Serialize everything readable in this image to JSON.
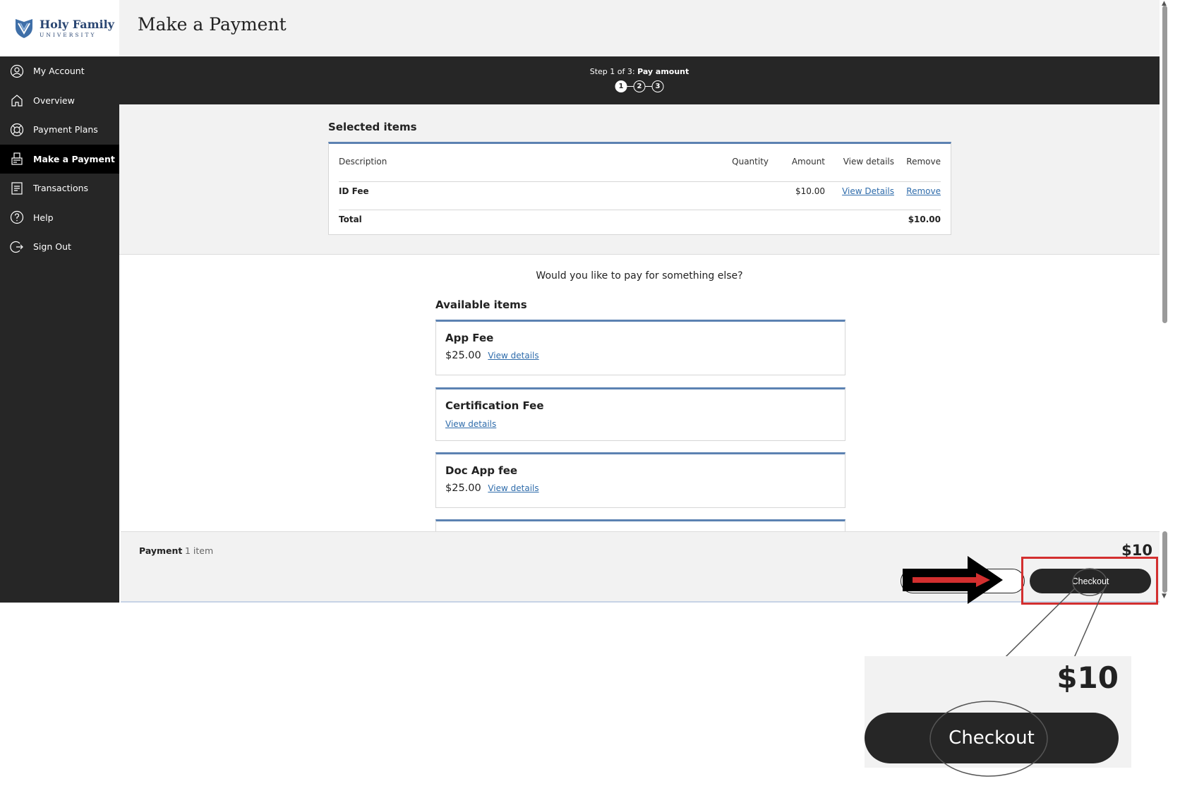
{
  "logo": {
    "name": "Holy Family",
    "sub": "UNIVERSITY"
  },
  "header": {
    "title": "Make a Payment"
  },
  "sidebar": {
    "items": [
      {
        "label": "My Account",
        "icon": "user-circle-icon",
        "active": false
      },
      {
        "label": "Overview",
        "icon": "home-icon",
        "active": false
      },
      {
        "label": "Payment Plans",
        "icon": "lifebuoy-icon",
        "active": false
      },
      {
        "label": "Make a Payment",
        "icon": "payment-terminal-icon",
        "active": true
      },
      {
        "label": "Transactions",
        "icon": "receipt-icon",
        "active": false
      },
      {
        "label": "Help",
        "icon": "help-circle-icon",
        "active": false
      },
      {
        "label": "Sign Out",
        "icon": "sign-out-icon",
        "active": false
      }
    ]
  },
  "stepper": {
    "prefix": "Step 1 of 3:",
    "current_step": "Pay amount",
    "steps": [
      "1",
      "2",
      "3"
    ],
    "current_index": 0
  },
  "selected": {
    "heading": "Selected items",
    "columns": {
      "description": "Description",
      "quantity": "Quantity",
      "amount": "Amount",
      "view_details": "View details",
      "remove": "Remove"
    },
    "rows": [
      {
        "description": "ID Fee",
        "quantity": "",
        "amount": "$10.00",
        "view_details": "View Details",
        "remove": "Remove"
      }
    ],
    "total_label": "Total",
    "total_value": "$10.00"
  },
  "available": {
    "question": "Would you like to pay for something else?",
    "heading": "Available items",
    "items": [
      {
        "name": "App Fee",
        "price": "$25.00",
        "link": "View details"
      },
      {
        "name": "Certification Fee",
        "price": "",
        "link": "View details"
      },
      {
        "name": "Doc App fee",
        "price": "$25.00",
        "link": "View details"
      }
    ]
  },
  "payment_footer": {
    "label": "Payment",
    "count": "1 item",
    "amount": "$10",
    "checkout": "Checkout"
  },
  "zoom": {
    "amount": "$10",
    "checkout": "Checkout"
  },
  "colors": {
    "sidebar_bg": "#262626",
    "accent_blue": "#5c82b2",
    "link": "#2f6cab",
    "highlight_red": "#d32f2f"
  }
}
